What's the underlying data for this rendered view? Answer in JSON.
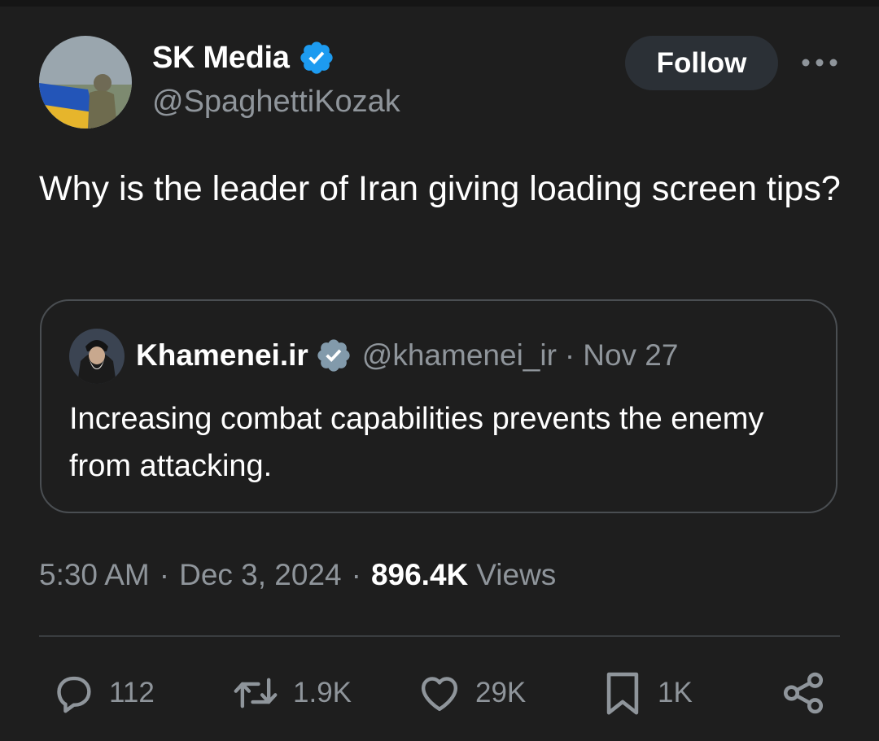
{
  "author": {
    "display_name": "SK Media",
    "handle": "@SpaghettiKozak",
    "verified": true
  },
  "follow_label": "Follow",
  "more_icon": "more-horizontal-icon",
  "tweet_text": "Why is the leader of Iran giving loading screen tips?",
  "quoted_tweet": {
    "display_name": "Khamenei.ir",
    "handle": "@khamenei_ir",
    "separator": "·",
    "date": "Nov 27",
    "verified": true,
    "text": "Increasing combat capabilities prevents the enemy from attacking."
  },
  "meta": {
    "time": "5:30 AM",
    "separator": "·",
    "date": "Dec 3, 2024",
    "views_count": "896.4K",
    "views_label": "Views"
  },
  "actions": {
    "replies": "112",
    "retweets": "1.9K",
    "likes": "29K",
    "bookmarks": "1K"
  },
  "colors": {
    "background": "#1e1e1e",
    "secondary_text": "#8f959b",
    "verified_blue": "#1d9bf0",
    "verified_gray": "#829aab",
    "follow_button_bg": "#2b3036"
  }
}
